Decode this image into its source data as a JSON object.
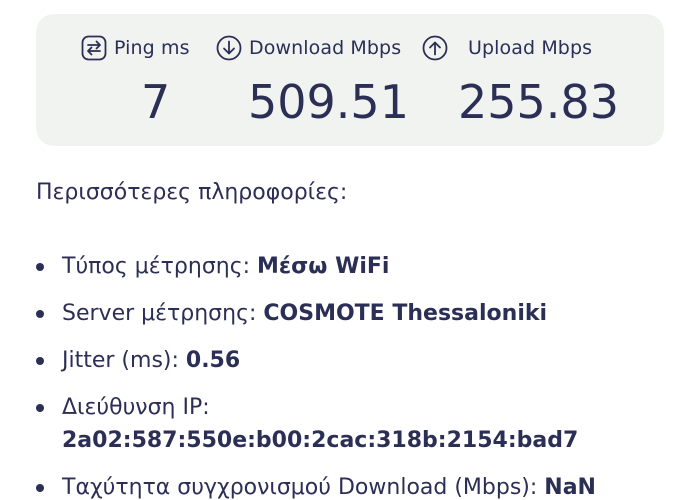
{
  "results": {
    "ping": {
      "label": "Ping ms",
      "value": "7",
      "icon": "swap-arrows-icon"
    },
    "download": {
      "label": "Download Mbps",
      "value": "509.51",
      "icon": "download-arrow-icon"
    },
    "upload": {
      "label": "Upload Mbps",
      "value": "255.83",
      "icon": "upload-arrow-icon"
    }
  },
  "more_info": {
    "title": "Περισσότερες πληροφορίες:",
    "items": [
      {
        "label": "Τύπος μέτρησης: ",
        "value": "Μέσω WiFi"
      },
      {
        "label": "Server μέτρησης: ",
        "value": "COSMOTE Thessaloniki"
      },
      {
        "label": "Jitter (ms): ",
        "value": "0.56"
      },
      {
        "label": "Διεύθυνση IP:",
        "value": "2a02:587:550e:b00:2cac:318b:2154:bad7"
      },
      {
        "label": "Ταχύτητα συγχρονισμού Download (Mbps): ",
        "value": "NaN"
      }
    ]
  },
  "colors": {
    "text": "#2c2f55",
    "card_background": "#f0f3ef"
  }
}
